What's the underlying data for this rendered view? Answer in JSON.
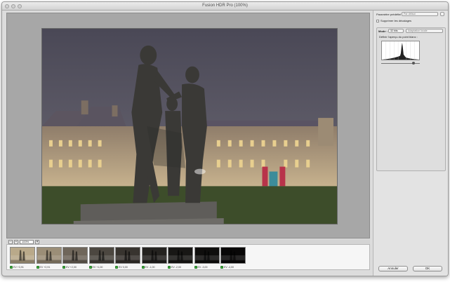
{
  "window": {
    "title": "Fusion HDR Pro (100%)"
  },
  "zoom": {
    "value": "100%"
  },
  "thumbnails": [
    {
      "label": "EV +3,91",
      "shade": "#b9a98a"
    },
    {
      "label": "EV +2,91",
      "shade": "#9b8e77"
    },
    {
      "label": "EV +2,00",
      "shade": "#6f665a"
    },
    {
      "label": "EV +1,00",
      "shade": "#4c4740"
    },
    {
      "label": "EV 0,00",
      "shade": "#38342f"
    },
    {
      "label": "EV -1,00",
      "shade": "#24221f"
    },
    {
      "label": "EV -2,00",
      "shade": "#181715"
    },
    {
      "label": "EV -3,00",
      "shade": "#0f0e0d"
    },
    {
      "label": "EV -4,00",
      "shade": "#080707"
    }
  ],
  "panel": {
    "preset_label": "Paramètre prédéfini :",
    "preset_value": "Par défaut",
    "remove_ghosts": "Supprimer les décalages",
    "mode_label": "Mode :",
    "mode_value": "32 bits",
    "method_value": "Adaptation locale",
    "white_point_label": "Définir l'aperçu du point blanc :"
  },
  "buttons": {
    "cancel": "Annuler",
    "ok": "OK"
  },
  "colors": {
    "check_green": "#3aa83a",
    "window_bg": "#dcdcdc"
  }
}
